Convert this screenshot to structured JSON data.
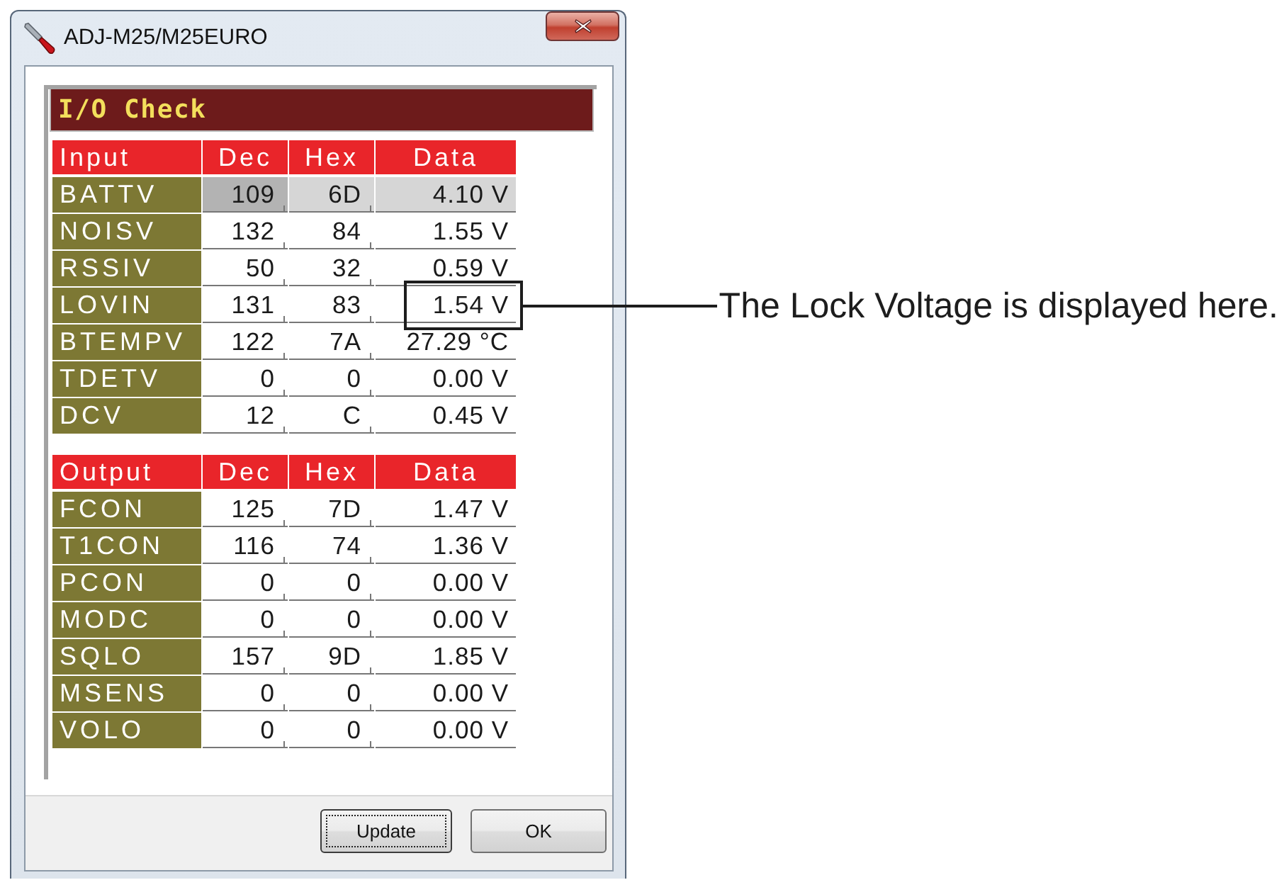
{
  "window": {
    "title": "ADJ-M25/M25EURO"
  },
  "panel": {
    "title": "I/O Check"
  },
  "tables": [
    {
      "header": [
        "Input",
        "Dec",
        "Hex",
        "Data"
      ],
      "rows": [
        {
          "name": "BATTV",
          "dec": "109",
          "hex": "6D",
          "data": "4.10 V",
          "selected": true,
          "highlighted": false
        },
        {
          "name": "NOISV",
          "dec": "132",
          "hex": "84",
          "data": "1.55 V",
          "selected": false,
          "highlighted": false
        },
        {
          "name": "RSSIV",
          "dec": "50",
          "hex": "32",
          "data": "0.59 V",
          "selected": false,
          "highlighted": false
        },
        {
          "name": "LOVIN",
          "dec": "131",
          "hex": "83",
          "data": "1.54 V",
          "selected": false,
          "highlighted": true
        },
        {
          "name": "BTEMPV",
          "dec": "122",
          "hex": "7A",
          "data": "27.29 °C",
          "selected": false,
          "highlighted": false
        },
        {
          "name": "TDETV",
          "dec": "0",
          "hex": "0",
          "data": "0.00 V",
          "selected": false,
          "highlighted": false
        },
        {
          "name": "DCV",
          "dec": "12",
          "hex": "C",
          "data": "0.45 V",
          "selected": false,
          "highlighted": false
        }
      ]
    },
    {
      "header": [
        "Output",
        "Dec",
        "Hex",
        "Data"
      ],
      "rows": [
        {
          "name": "FCON",
          "dec": "125",
          "hex": "7D",
          "data": "1.47 V",
          "selected": false,
          "highlighted": false
        },
        {
          "name": "T1CON",
          "dec": "116",
          "hex": "74",
          "data": "1.36 V",
          "selected": false,
          "highlighted": false
        },
        {
          "name": "PCON",
          "dec": "0",
          "hex": "0",
          "data": "0.00 V",
          "selected": false,
          "highlighted": false
        },
        {
          "name": "MODC",
          "dec": "0",
          "hex": "0",
          "data": "0.00 V",
          "selected": false,
          "highlighted": false
        },
        {
          "name": "SQLO",
          "dec": "157",
          "hex": "9D",
          "data": "1.85 V",
          "selected": false,
          "highlighted": false
        },
        {
          "name": "MSENS",
          "dec": "0",
          "hex": "0",
          "data": "0.00 V",
          "selected": false,
          "highlighted": false
        },
        {
          "name": "VOLO",
          "dec": "0",
          "hex": "0",
          "data": "0.00 V",
          "selected": false,
          "highlighted": false
        }
      ]
    }
  ],
  "buttons": [
    {
      "label": "Update",
      "focused": true
    },
    {
      "label": "OK",
      "focused": false
    }
  ],
  "callout": {
    "text": "The Lock Voltage is displayed here."
  }
}
